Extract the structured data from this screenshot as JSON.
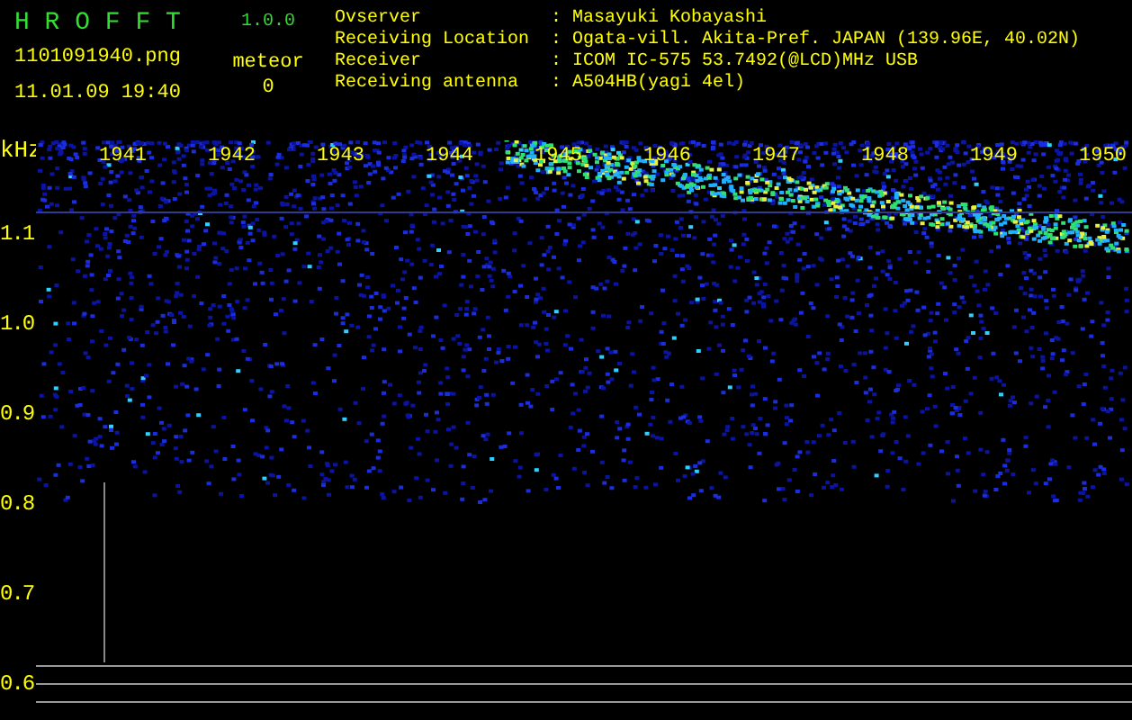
{
  "app": {
    "title": "H R O F F T",
    "version": "1.0.0"
  },
  "file": {
    "name": "1101091940.png",
    "datetime": "11.01.09 19:40"
  },
  "meteor": {
    "label": "meteor",
    "count": "0"
  },
  "info": [
    {
      "label": "Ovserver",
      "separator": ":",
      "value": "Masayuki Kobayashi"
    },
    {
      "label": "Receiving Location",
      "separator": ":",
      "value": "Ogata-vill. Akita-Pref. JAPAN (139.96E, 40.02N)"
    },
    {
      "label": "Receiver",
      "separator": ":",
      "value": "ICOM IC-575 53.7492(@LCD)MHz USB"
    },
    {
      "label": "Receiving antenna",
      "separator": ":",
      "value": "A504HB(yagi 4el)"
    }
  ],
  "spectrogram": {
    "unit": "kHz",
    "time_labels": [
      "1941",
      "1942",
      "1943",
      "1944",
      "1945",
      "1946",
      "1947",
      "1948",
      "1949",
      "1950"
    ],
    "frequency_labels": [
      "1.1",
      "1.0",
      "0.9",
      "0.8",
      "0.7",
      "0.6"
    ]
  }
}
